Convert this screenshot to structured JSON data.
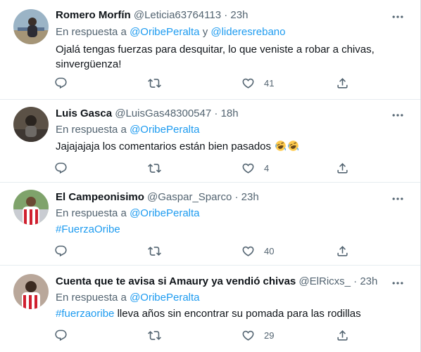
{
  "reply_prefix": "En respuesta a",
  "conjunction": "y",
  "tweets": [
    {
      "name": "Romero Morfín",
      "handle": "@Leticia63764113",
      "time": "23h",
      "mentions": [
        "@OribePeralta",
        "@lideresrebano"
      ],
      "text_line1": "Ojalá tengas fuerzas para desquitar, lo que veniste a robar a chivas,",
      "text_line2": "sinvergüenza!",
      "likes": "41"
    },
    {
      "name": "Luis Gasca",
      "handle": "@LuisGas48300547",
      "time": "18h",
      "mentions": [
        "@OribePeralta"
      ],
      "text": "Jajajajaja los comentarios están bien pasados",
      "emojis": [
        "rofl-emoji",
        "rofl-emoji"
      ],
      "likes": "4"
    },
    {
      "name": "El Campeonisimo",
      "handle": "@Gaspar_Sparco",
      "time": "23h",
      "mentions": [
        "@OribePeralta"
      ],
      "hashtag": "#FuerzaOribe",
      "likes": "40"
    },
    {
      "name": "Cuenta que te avisa si Amaury ya vendió chivas",
      "handle": "@ElRicxs_",
      "time": "23h",
      "mentions": [
        "@OribePeralta"
      ],
      "hashtag": "#fuerzaoribe",
      "text_rest": "lleva años sin encontrar su pomada para las rodillas",
      "likes": "29"
    }
  ],
  "icons": {
    "reply": "reply-icon",
    "retweet": "retweet-icon",
    "like": "like-icon",
    "share": "share-icon",
    "more": "more-icon"
  },
  "colors": {
    "accent": "#1d9bf0",
    "secondary_text": "#536471",
    "primary_text": "#0f1419",
    "divider": "#e6ecf0"
  }
}
